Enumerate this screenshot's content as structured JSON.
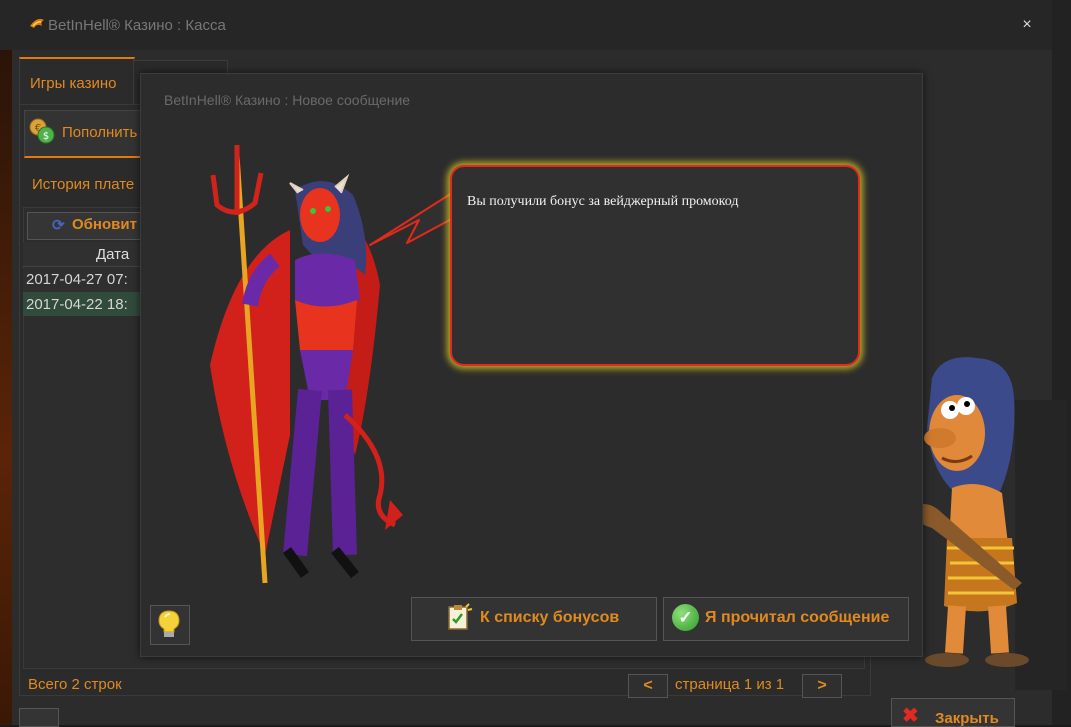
{
  "window": {
    "title": "BetInHell® Казино : Касса",
    "close_glyph": "×"
  },
  "tabs": [
    {
      "label": "Игры казино",
      "active": true
    },
    {
      "label": "",
      "active": false
    }
  ],
  "toolbar": {
    "deposit_label": "Пополнить"
  },
  "history": {
    "title": "История плате",
    "refresh_label": "Обновит",
    "columns": [
      "Дата"
    ],
    "rows": [
      {
        "date": "2017-04-27 07:"
      },
      {
        "date": "2017-04-22 18:"
      }
    ],
    "total": "Всего 2 строк",
    "prev": "<",
    "page_info": "страница 1 из 1",
    "next": ">"
  },
  "footer": {
    "close_label": "Закрыть"
  },
  "modal": {
    "title": "BetInHell® Казино : Новое сообщение",
    "message": "Вы получили бонус за вейджерный промокод",
    "bonus_list_label": "К списку бонусов",
    "read_label": "Я прочитал сообщение"
  },
  "colors": {
    "accent": "#e08a20",
    "bubble_border": "#e22a1a",
    "bubble_glow": "#e6d228",
    "selected_row": "#304a3c"
  },
  "icons": {
    "deposit": "coins-icon",
    "refresh": "refresh-icon",
    "bonus_list": "clipboard-icon",
    "read": "check-icon",
    "hint": "lightbulb-icon",
    "close": "close-icon"
  }
}
